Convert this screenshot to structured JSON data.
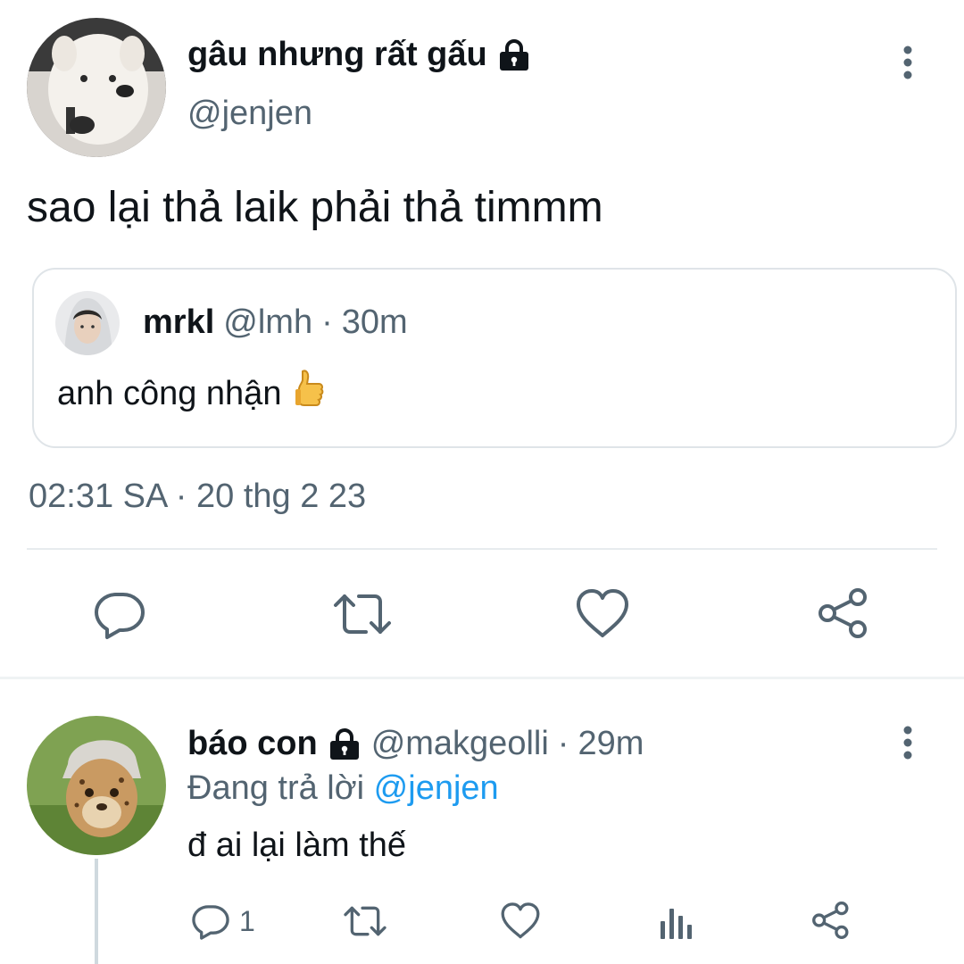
{
  "tweet": {
    "author_name": "gâu nhưng rất gấu",
    "author_handle": "@jenjen",
    "text": "sao lại thả laik phải thả timmm",
    "timestamp": "02:31 SA · 20 thg 2 23",
    "locked_icon": "lock-icon",
    "quoted": {
      "author_name": "mrkl",
      "author_handle": "@lmh",
      "separator": "·",
      "time_ago": "30m",
      "text": "anh công nhận",
      "emoji_icon": "thumbs-up-icon"
    },
    "actions": [
      {
        "name": "reply",
        "icon": "reply-icon"
      },
      {
        "name": "retweet",
        "icon": "retweet-icon"
      },
      {
        "name": "like",
        "icon": "heart-icon"
      },
      {
        "name": "share",
        "icon": "share-icon"
      }
    ]
  },
  "reply": {
    "author_name": "báo con",
    "author_handle": "@makgeolli",
    "separator": "·",
    "time_ago": "29m",
    "replying_prefix": "Đang trả lời",
    "replying_to": "@jenjen",
    "text": "đ ai lại làm thế",
    "reply_count": "1",
    "actions": [
      {
        "name": "reply",
        "icon": "reply-icon"
      },
      {
        "name": "retweet",
        "icon": "retweet-icon"
      },
      {
        "name": "like",
        "icon": "heart-icon"
      },
      {
        "name": "analytics",
        "icon": "bar-chart-icon"
      },
      {
        "name": "share",
        "icon": "share-icon"
      }
    ]
  },
  "colors": {
    "text": "#0f1419",
    "muted": "#536471",
    "link": "#1d9bf0",
    "border": "#dfe4e8"
  }
}
